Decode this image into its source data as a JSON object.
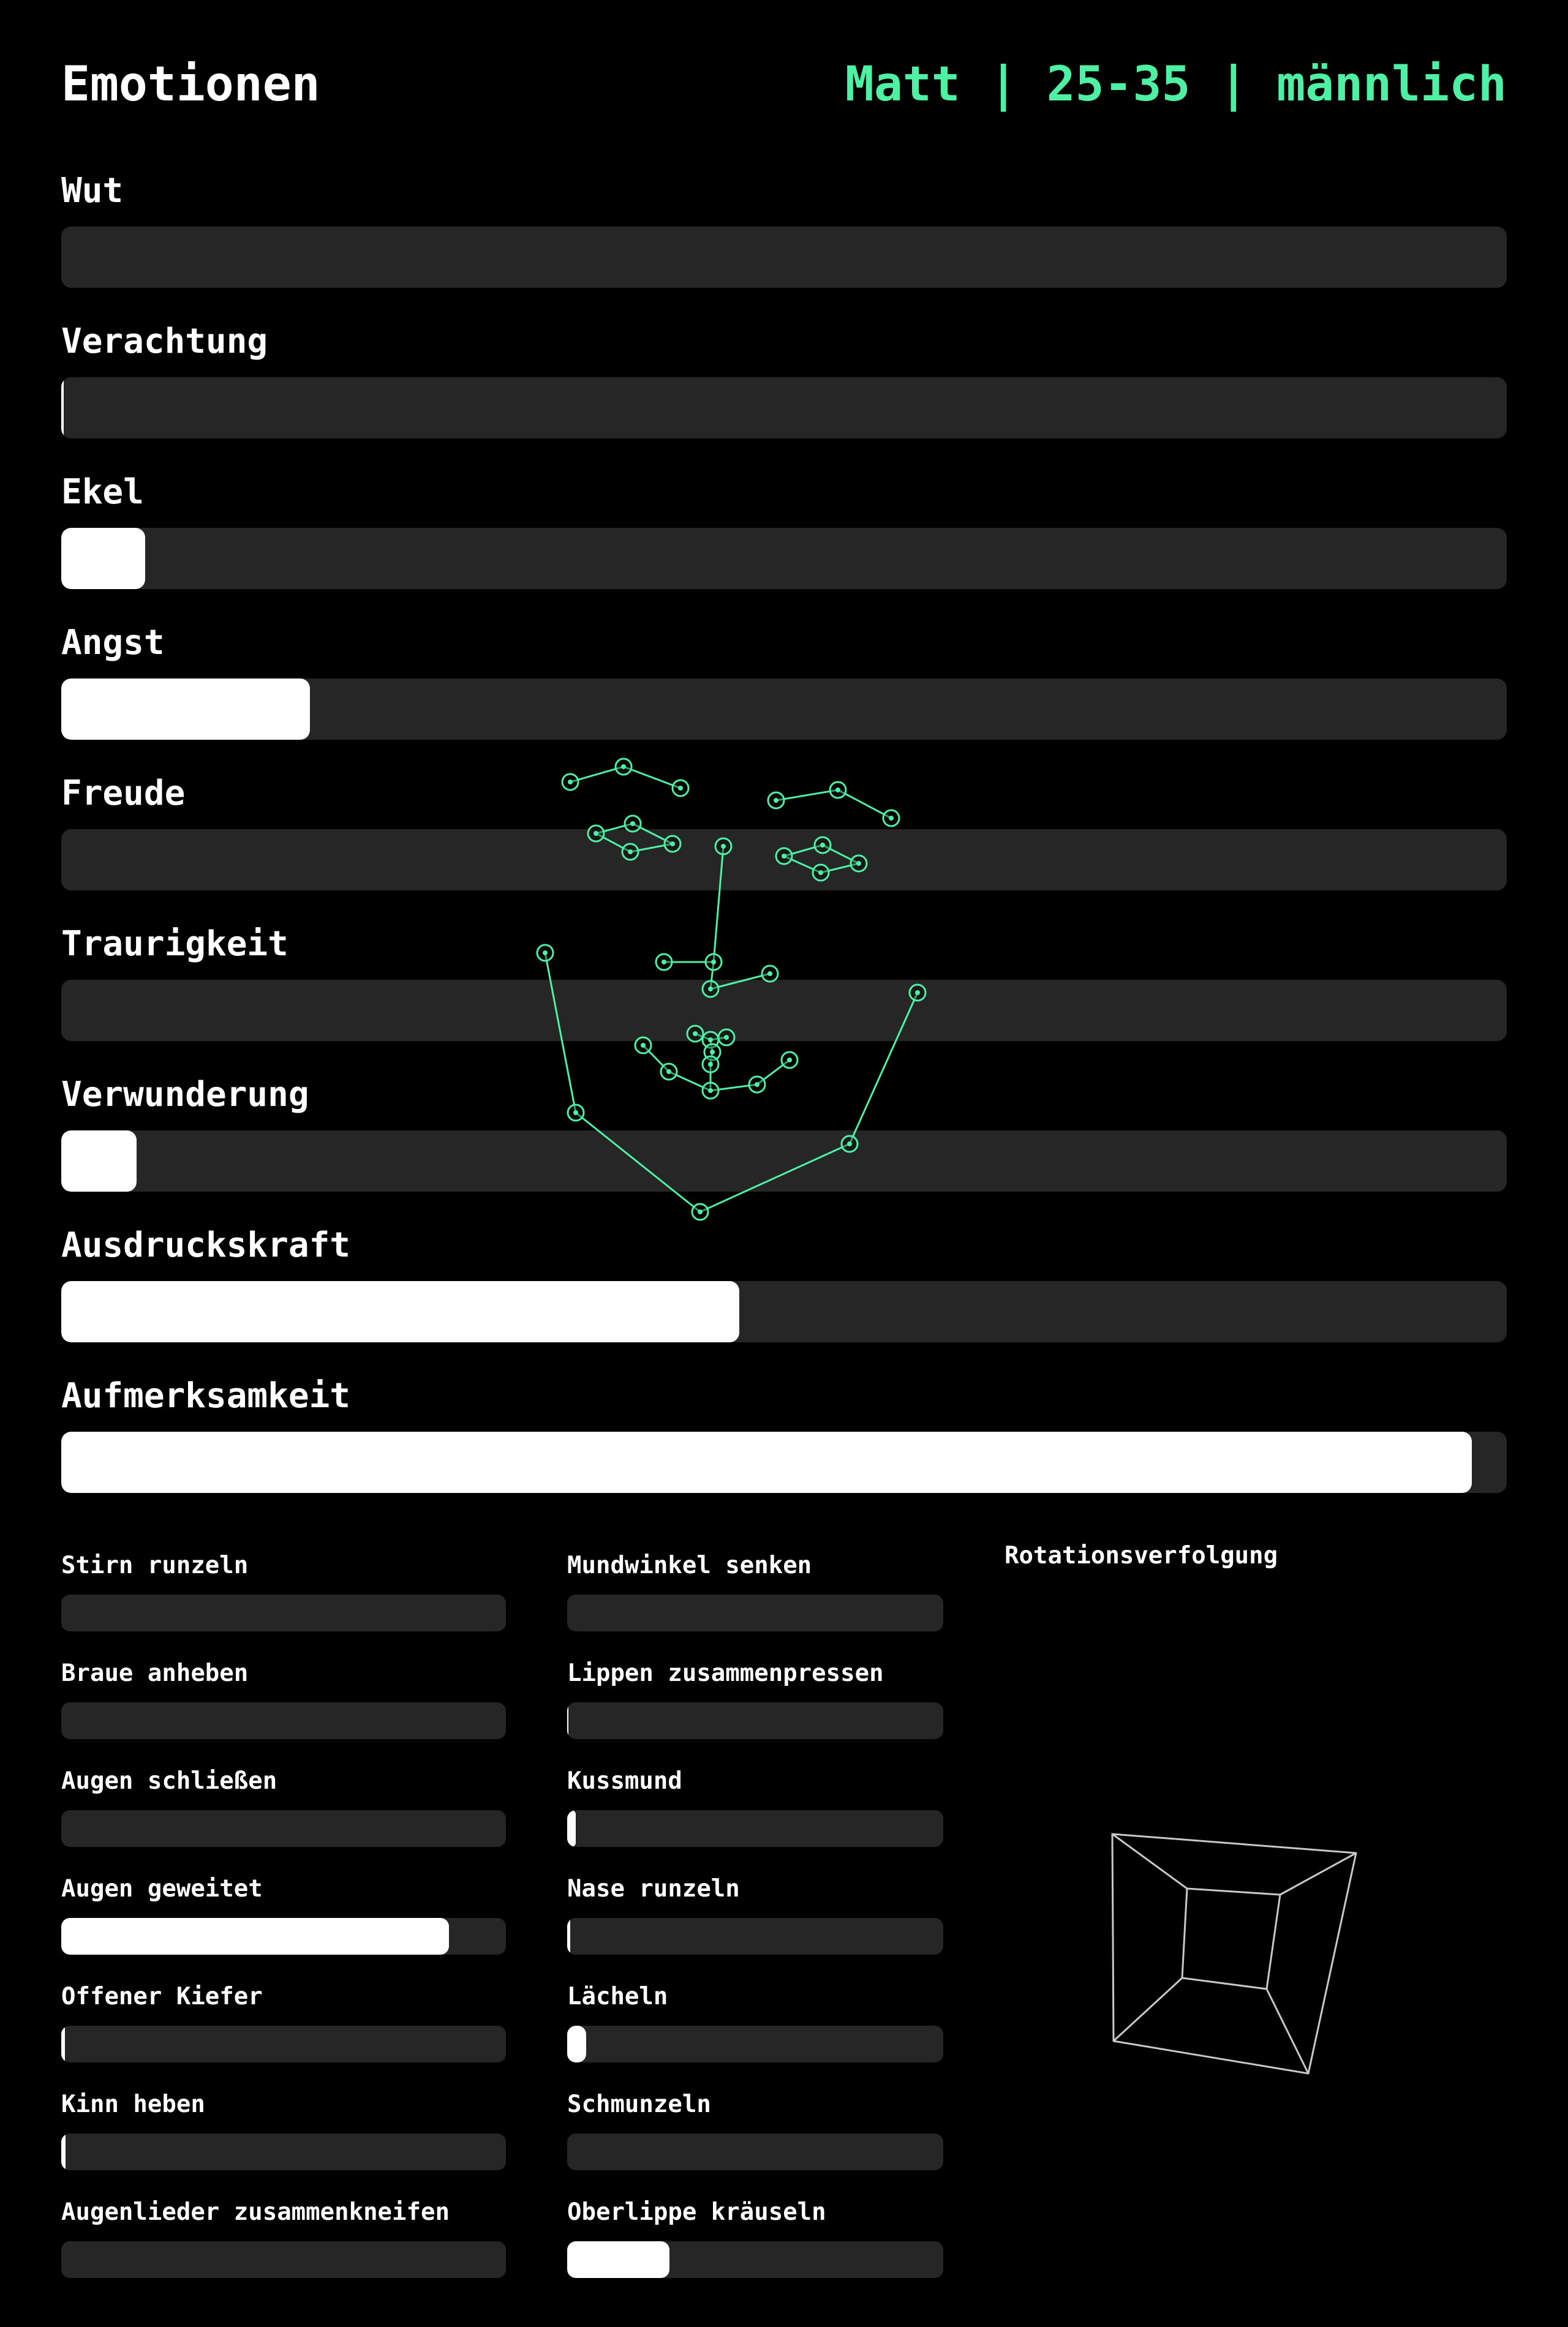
{
  "header": {
    "title": "Emotionen",
    "profile": "Matt | 25-35 | männlich",
    "accent_color": "#4ef0a4"
  },
  "emotions": [
    {
      "label": "Wut",
      "value": 0.0
    },
    {
      "label": "Verachtung",
      "value": 0.002
    },
    {
      "label": "Ekel",
      "value": 0.058
    },
    {
      "label": "Angst",
      "value": 0.172
    },
    {
      "label": "Freude",
      "value": 0.0
    },
    {
      "label": "Traurigkeit",
      "value": 0.0
    },
    {
      "label": "Verwunderung",
      "value": 0.052
    },
    {
      "label": "Ausdruckskraft",
      "value": 0.469
    },
    {
      "label": "Aufmerksamkeit",
      "value": 0.976
    }
  ],
  "action_units_left": [
    {
      "label": "Stirn runzeln",
      "value": 0.0
    },
    {
      "label": "Braue anheben",
      "value": 0.0
    },
    {
      "label": "Augen schließen",
      "value": 0.0
    },
    {
      "label": "Augen geweitet",
      "value": 0.872
    },
    {
      "label": "Offener Kiefer",
      "value": 0.008
    },
    {
      "label": "Kinn heben",
      "value": 0.01
    },
    {
      "label": "Augenlieder zusammenkneifen",
      "value": 0.0
    }
  ],
  "action_units_right": [
    {
      "label": "Mundwinkel senken",
      "value": 0.0
    },
    {
      "label": "Lippen zusammenpressen",
      "value": 0.004
    },
    {
      "label": "Kussmund",
      "value": 0.022
    },
    {
      "label": "Nase runzeln",
      "value": 0.008
    },
    {
      "label": "Lächeln",
      "value": 0.05
    },
    {
      "label": "Schmunzeln",
      "value": 0.0
    },
    {
      "label": "Oberlippe kräuseln",
      "value": 0.272
    }
  ],
  "rotation": {
    "label": "Rotationsverfolgung"
  }
}
